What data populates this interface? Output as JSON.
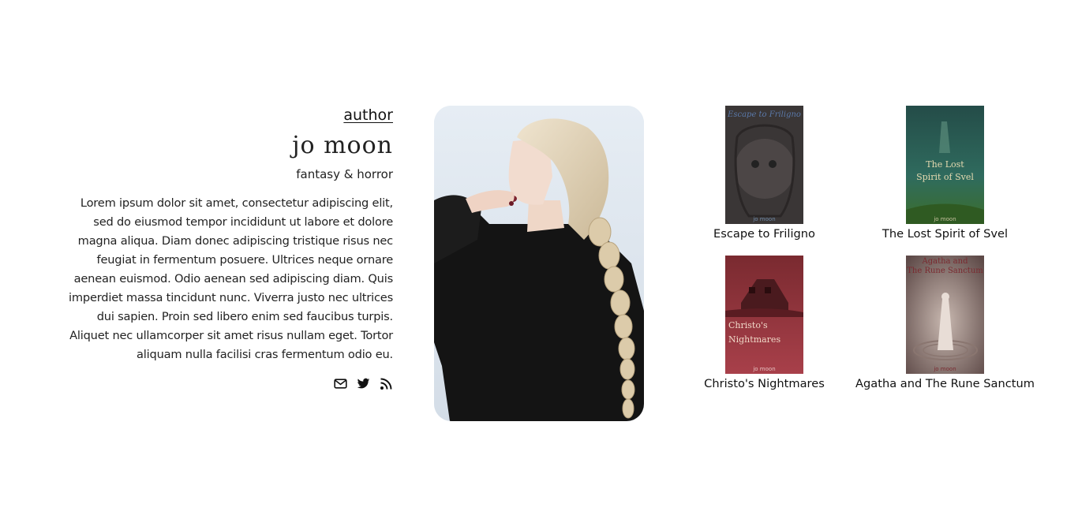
{
  "bio": {
    "section_label": "author",
    "name": "jo moon",
    "genre": "fantasy & horror",
    "blurb": "Lorem ipsum dolor sit amet, consectetur adipiscing elit, sed do eiusmod tempor incididunt ut labore et dolore magna aliqua. Diam donec adipiscing tristique risus nec feugiat in fermentum posuere. Ultrices neque ornare aenean euismod. Odio aenean sed adipiscing diam. Quis imperdiet massa tincidunt nunc. Viverra justo nec ultrices dui sapien. Proin sed libero enim sed faucibus turpis. Aliquet nec ullamcorper sit amet risus nullam eget. Tortor aliquam nulla facilisi cras fermentum odio eu.",
    "social_icons": [
      "envelope-icon",
      "twitter-icon",
      "rss-icon"
    ]
  },
  "portrait": {
    "subject": "woman with blonde braid, black jacket"
  },
  "books": [
    {
      "title": "Escape to Friligno",
      "cover_title": "Escape to Friligno",
      "cover_author": "jo moon",
      "cover_color": "#3a3636"
    },
    {
      "title": "The Lost Spirit of Svel",
      "cover_title": "The Lost Spirit of Svel",
      "cover_author": "jo moon",
      "cover_color": "#2c5a50"
    },
    {
      "title": "Christo's Nightmares",
      "cover_title": "Christo's Nightmares",
      "cover_author": "jo moon",
      "cover_color": "#8b3036"
    },
    {
      "title": "Agatha and The Rune Sanctum",
      "cover_title": "Agatha and The Rune Sanctum",
      "cover_author": "jo moon",
      "cover_color": "#6e5a56"
    }
  ]
}
